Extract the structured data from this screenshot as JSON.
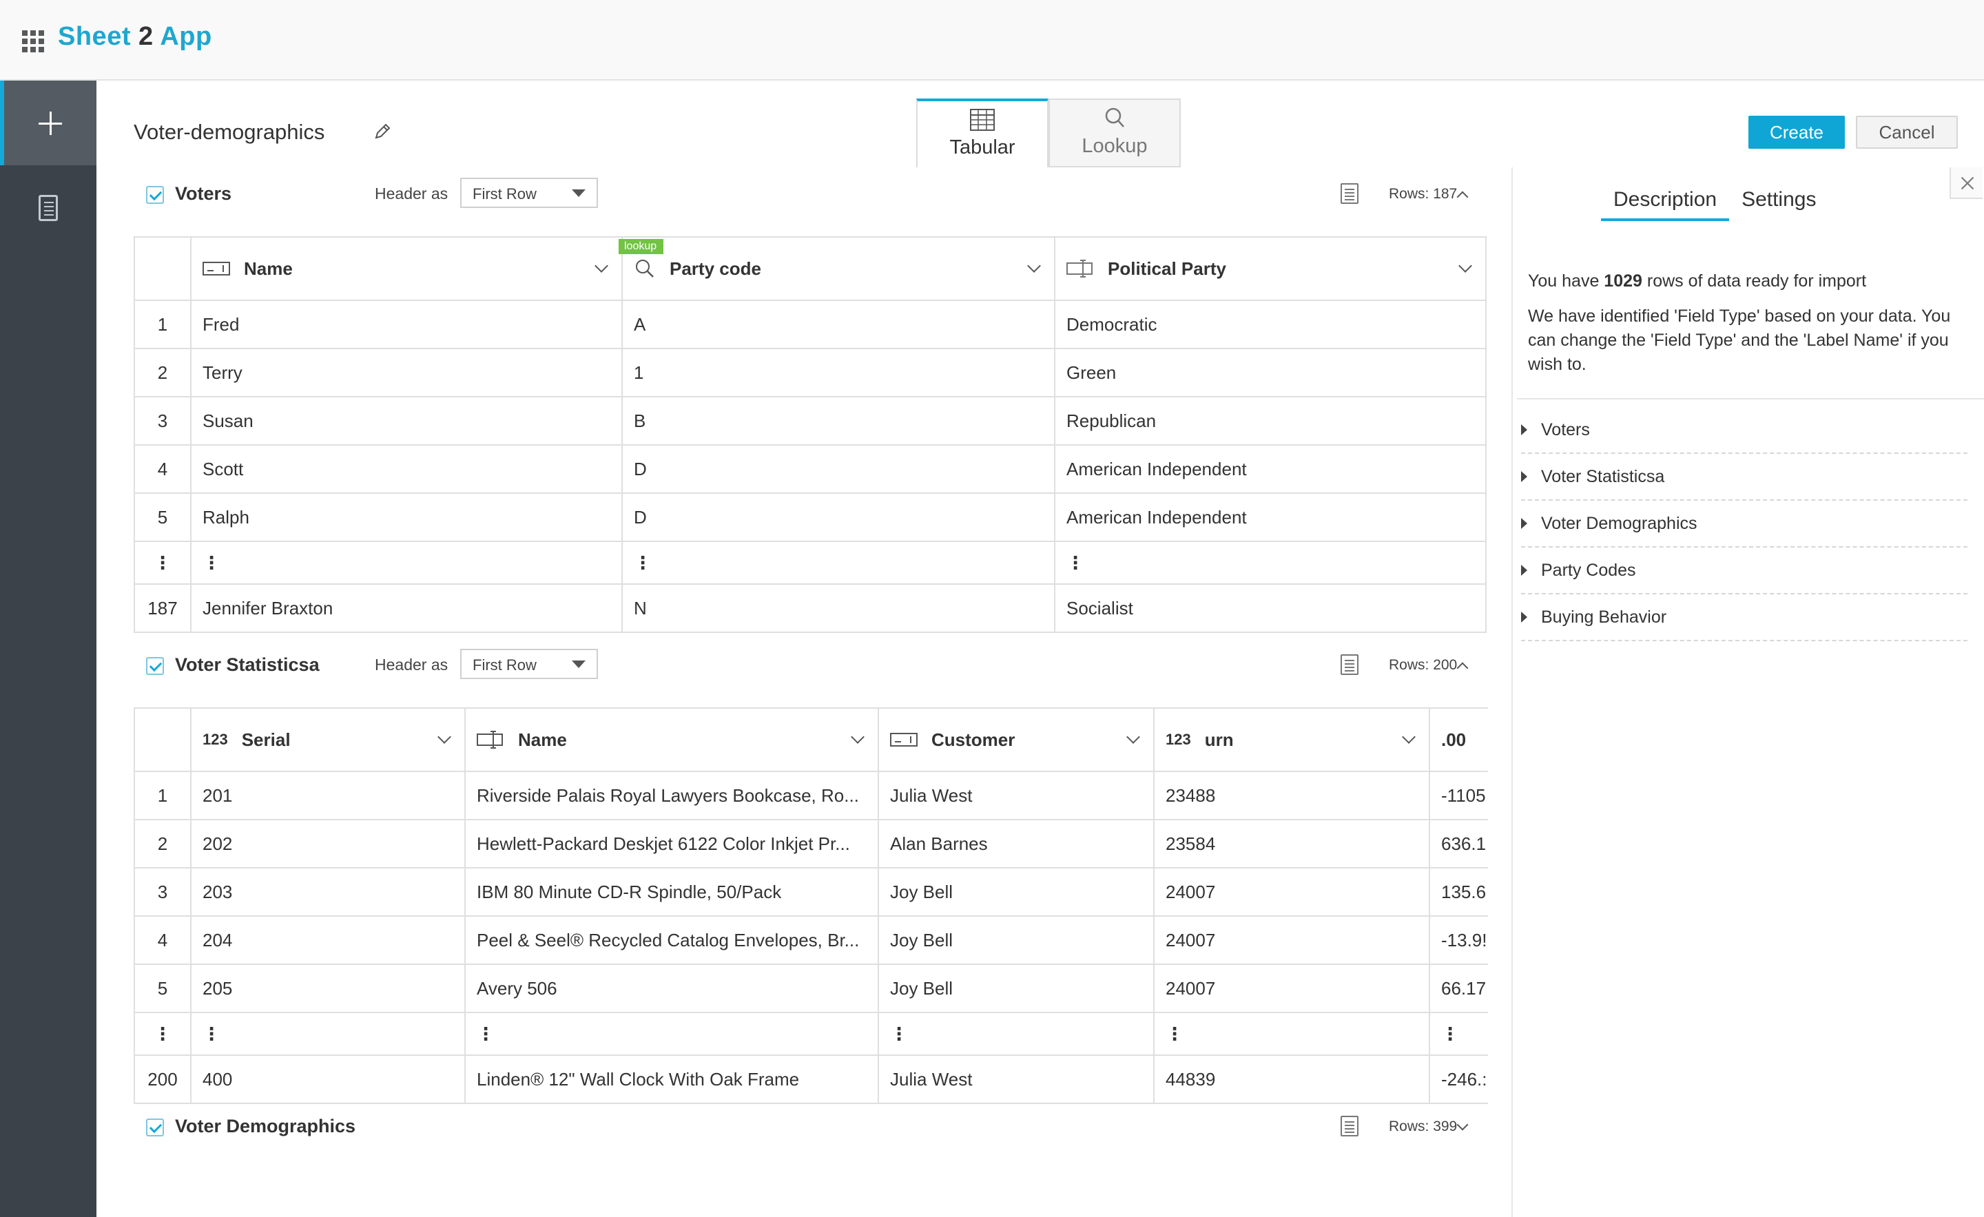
{
  "app": {
    "brand_part1": "Sheet",
    "brand_part2": "2",
    "brand_part3": "App"
  },
  "document": {
    "title": "Voter-demographics"
  },
  "view_tabs": {
    "tabular": "Tabular",
    "lookup": "Lookup"
  },
  "actions": {
    "create": "Create",
    "cancel": "Cancel"
  },
  "header_as_label": "Header as",
  "sheets": [
    {
      "name": "Voters",
      "header_as": "First Row",
      "rows_label": "Rows:",
      "rows_count": "187",
      "lookup_tag": "lookup",
      "columns": [
        "Name",
        "Party code",
        "Political Party"
      ],
      "rows": [
        {
          "n": "1",
          "cells": [
            "Fred",
            "A",
            "Democratic"
          ]
        },
        {
          "n": "2",
          "cells": [
            "Terry",
            "1",
            "Green"
          ]
        },
        {
          "n": "3",
          "cells": [
            "Susan",
            "B",
            "Republican"
          ]
        },
        {
          "n": "4",
          "cells": [
            "Scott",
            "D",
            "American Independent"
          ]
        },
        {
          "n": "5",
          "cells": [
            "Ralph",
            "D",
            "American Independent"
          ]
        },
        {
          "n": "⋮",
          "cells": [
            "⋮",
            "⋮",
            "⋮"
          ]
        },
        {
          "n": "187",
          "cells": [
            "Jennifer Braxton",
            "N",
            "Socialist"
          ]
        }
      ]
    },
    {
      "name": "Voter Statisticsa",
      "header_as": "First Row",
      "rows_label": "Rows:",
      "rows_count": "200",
      "num_icon": "123",
      "columns": [
        "Serial",
        "Name",
        "Customer",
        "urn",
        ".00"
      ],
      "rows": [
        {
          "n": "1",
          "cells": [
            "201",
            "Riverside Palais Royal Lawyers Bookcase, Ro...",
            "Julia West",
            "23488",
            "-1105"
          ]
        },
        {
          "n": "2",
          "cells": [
            "202",
            "Hewlett-Packard Deskjet 6122 Color Inkjet Pr...",
            "Alan Barnes",
            "23584",
            "636.1"
          ]
        },
        {
          "n": "3",
          "cells": [
            "203",
            "IBM 80 Minute CD-R Spindle, 50/Pack",
            "Joy Bell",
            "24007",
            "135.6"
          ]
        },
        {
          "n": "4",
          "cells": [
            "204",
            "Peel & Seel® Recycled Catalog Envelopes, Br...",
            "Joy Bell",
            "24007",
            "-13.9!"
          ]
        },
        {
          "n": "5",
          "cells": [
            "205",
            "Avery 506",
            "Joy Bell",
            "24007",
            "66.17"
          ]
        },
        {
          "n": "⋮",
          "cells": [
            "⋮",
            "⋮",
            "⋮",
            "⋮",
            "⋮"
          ]
        },
        {
          "n": "200",
          "cells": [
            "400",
            "Linden® 12\" Wall Clock With Oak Frame",
            "Julia West",
            "44839",
            "-246.:"
          ]
        }
      ]
    },
    {
      "name": "Voter Demographics",
      "rows_label": "Rows:",
      "rows_count": "399"
    }
  ],
  "right_panel": {
    "tabs": [
      "Description",
      "Settings"
    ],
    "line1_pre": "You have ",
    "line1_count": "1029",
    "line1_post": " rows of data ready for import",
    "line2": "We have identified 'Field Type' based on your data. You can change the 'Field Type' and the 'Label Name' if you wish to.",
    "items": [
      "Voters",
      "Voter Statisticsa",
      "Voter Demographics",
      "Party Codes",
      "Buying Behavior"
    ]
  },
  "colors": {
    "accent": "#14a9d8",
    "sidebar": "#3b4249",
    "lookup_tag": "#72c343"
  }
}
